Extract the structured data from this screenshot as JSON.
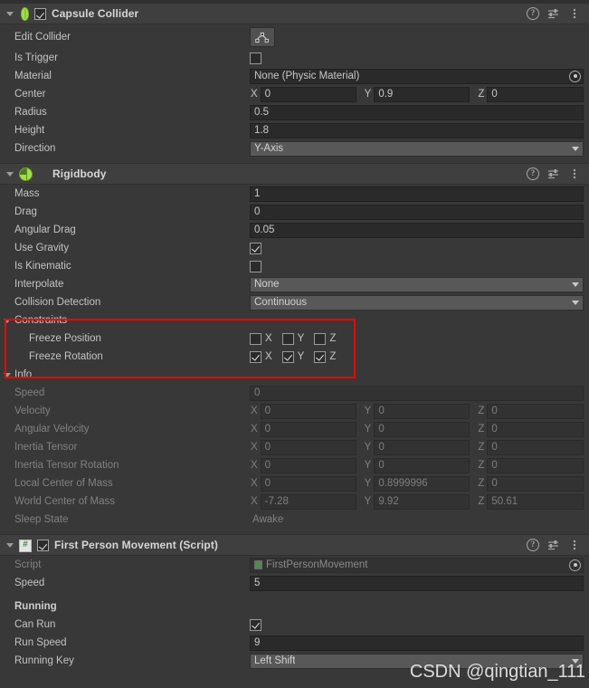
{
  "colors": {
    "panel_bg": "#383838",
    "header_bg": "#3f3f3f",
    "field_bg": "#2a2a2a",
    "dropdown_bg": "#585858",
    "accent_green": "#9fe04c",
    "annotation_red": "#ff0000"
  },
  "components": [
    {
      "id": "capsule-collider",
      "title": "Capsule Collider",
      "icon": "capsule-icon",
      "enabled": true,
      "has_enable_checkbox": true,
      "header_icons": [
        "help-icon",
        "presets-icon",
        "more-menu-icon"
      ],
      "rows": {
        "edit_collider_label": "Edit Collider",
        "edit_collider_button_icon": "edit-collider-icon",
        "is_trigger_label": "Is Trigger",
        "is_trigger_value": false,
        "material_label": "Material",
        "material_value": "None (Physic Material)",
        "center_label": "Center",
        "center": {
          "x_label": "X",
          "x": "0",
          "y_label": "Y",
          "y": "0.9",
          "z_label": "Z",
          "z": "0"
        },
        "radius_label": "Radius",
        "radius_value": "0.5",
        "height_label": "Height",
        "height_value": "1.8",
        "direction_label": "Direction",
        "direction_value": "Y-Axis"
      }
    },
    {
      "id": "rigidbody",
      "title": "Rigidbody",
      "icon": "rigidbody-ball-icon",
      "has_enable_checkbox": false,
      "header_icons": [
        "help-icon",
        "presets-icon",
        "more-menu-icon"
      ],
      "rows": {
        "mass_label": "Mass",
        "mass_value": "1",
        "drag_label": "Drag",
        "drag_value": "0",
        "angular_drag_label": "Angular Drag",
        "angular_drag_value": "0.05",
        "use_gravity_label": "Use Gravity",
        "use_gravity_value": true,
        "is_kinematic_label": "Is Kinematic",
        "is_kinematic_value": false,
        "interpolate_label": "Interpolate",
        "interpolate_value": "None",
        "collision_detection_label": "Collision Detection",
        "collision_detection_value": "Continuous"
      },
      "constraints": {
        "foldout_label": "Constraints",
        "freeze_position_label": "Freeze Position",
        "freeze_position": {
          "x": false,
          "y": false,
          "z": false
        },
        "freeze_rotation_label": "Freeze Rotation",
        "freeze_rotation": {
          "x": true,
          "y": true,
          "z": true
        },
        "axis_labels": {
          "x": "X",
          "y": "Y",
          "z": "Z"
        }
      },
      "info": {
        "foldout_label": "Info",
        "speed_label": "Speed",
        "speed_value": "0",
        "velocity_label": "Velocity",
        "velocity": {
          "x": "0",
          "y": "0",
          "z": "0"
        },
        "angular_velocity_label": "Angular Velocity",
        "angular_velocity": {
          "x": "0",
          "y": "0",
          "z": "0"
        },
        "inertia_tensor_label": "Inertia Tensor",
        "inertia_tensor": {
          "x": "0",
          "y": "0",
          "z": "0"
        },
        "inertia_tensor_rotation_label": "Inertia Tensor Rotation",
        "inertia_tensor_rotation": {
          "x": "0",
          "y": "0",
          "z": "0"
        },
        "local_center_of_mass_label": "Local Center of Mass",
        "local_center_of_mass": {
          "x": "0",
          "y": "0.8999996",
          "z": "0"
        },
        "world_center_of_mass_label": "World Center of Mass",
        "world_center_of_mass": {
          "x": "-7.28",
          "y": "9.92",
          "z": "50.61"
        },
        "sleep_state_label": "Sleep State",
        "sleep_state_value": "Awake",
        "axis_labels": {
          "x": "X",
          "y": "Y",
          "z": "Z"
        }
      }
    },
    {
      "id": "first-person-movement",
      "title": "First Person Movement (Script)",
      "icon": "csharp-script-icon",
      "enabled": true,
      "has_enable_checkbox": true,
      "header_icons": [
        "help-icon",
        "presets-icon",
        "more-menu-icon"
      ],
      "rows": {
        "script_label": "Script",
        "script_value": "FirstPersonMovement",
        "speed_label": "Speed",
        "speed_value": "5",
        "running_header": "Running",
        "can_run_label": "Can Run",
        "can_run_value": true,
        "run_speed_label": "Run Speed",
        "run_speed_value": "9",
        "running_key_label": "Running Key",
        "running_key_value": "Left Shift"
      }
    }
  ],
  "annotation": {
    "type": "red-rectangle",
    "target": "Constraints section"
  },
  "watermark": "CSDN @qingtian_111"
}
